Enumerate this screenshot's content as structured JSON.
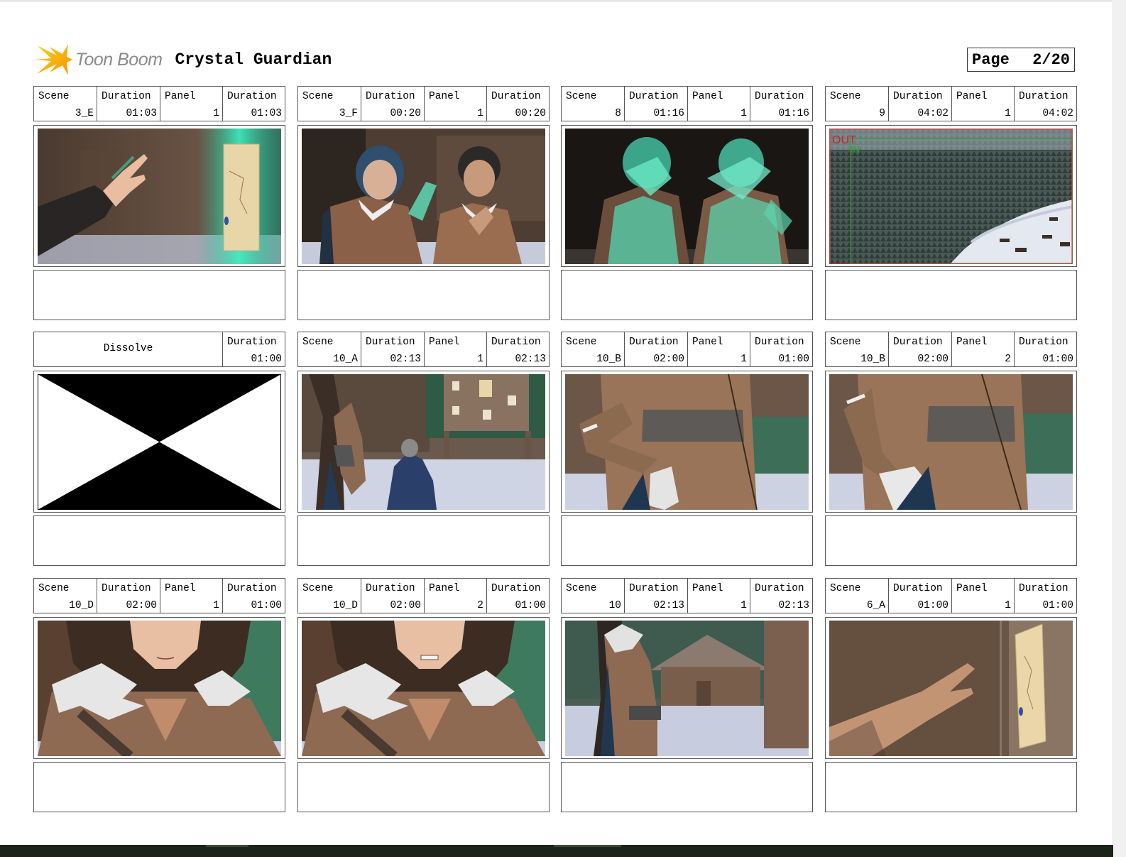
{
  "header": {
    "brand": "Toon Boom",
    "project_title": "Crystal Guardian",
    "page_label": "Page",
    "page_number": "2/20"
  },
  "labels": {
    "scene": "Scene",
    "duration": "Duration",
    "panel": "Panel"
  },
  "panels": [
    {
      "scene": "3_E",
      "scene_duration": "01:03",
      "panel": "1",
      "panel_duration": "01:03",
      "image": "hand-reaching-glowing-map"
    },
    {
      "scene": "3_F",
      "scene_duration": "00:20",
      "panel": "1",
      "panel_duration": "00:20",
      "image": "two-boys-shielding-eyes"
    },
    {
      "scene": "8",
      "scene_duration": "01:16",
      "panel": "1",
      "panel_duration": "01:16",
      "image": "two-boys-covering-faces-green-glow"
    },
    {
      "scene": "9",
      "scene_duration": "04:02",
      "panel": "1",
      "panel_duration": "04:02",
      "image": "aerial-snowy-forest-village",
      "camera_marks": [
        "OUT",
        "IN"
      ]
    },
    {
      "transition": "Dissolve",
      "transition_duration": "01:00",
      "image": "dissolve-transition"
    },
    {
      "scene": "10_A",
      "scene_duration": "02:13",
      "panel": "1",
      "panel_duration": "02:13",
      "image": "girl-near-notice-board-hooded-figure"
    },
    {
      "scene": "10_B",
      "scene_duration": "02:00",
      "panel": "1",
      "panel_duration": "01:00",
      "image": "torso-hand-on-fur-pouch"
    },
    {
      "scene": "10_B",
      "scene_duration": "02:00",
      "panel": "2",
      "panel_duration": "01:00",
      "image": "torso-pulling-fur-pouch"
    },
    {
      "scene": "10_D",
      "scene_duration": "02:00",
      "panel": "1",
      "panel_duration": "01:00",
      "image": "girl-face-closeup-calm"
    },
    {
      "scene": "10_D",
      "scene_duration": "02:00",
      "panel": "2",
      "panel_duration": "01:00",
      "image": "girl-face-closeup-clenched"
    },
    {
      "scene": "10",
      "scene_duration": "02:13",
      "panel": "1",
      "panel_duration": "02:13",
      "image": "girl-profile-village-hut"
    },
    {
      "scene": "6_A",
      "scene_duration": "01:00",
      "panel": "1",
      "panel_duration": "01:00",
      "image": "hand-touching-map-on-post"
    }
  ]
}
